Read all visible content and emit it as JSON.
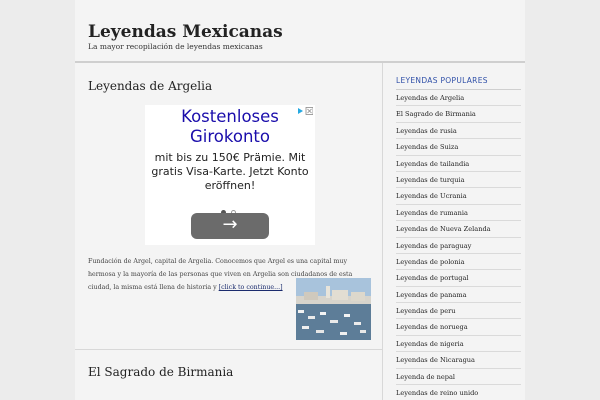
{
  "site": {
    "title": "Leyendas Mexicanas",
    "description": "La mayor recopilación de leyendas mexicanas"
  },
  "posts": [
    {
      "title": "Leyendas de Argelia",
      "excerpt": "Fundación de Argel, capital de Argelia. Conocemos que Argel es una capital muy hermosa y la mayoría de las personas que viven en Argelia son ciudadanos de esta ciudad, la misma está llena de historia y",
      "more_label": "[click to continue...]"
    },
    {
      "title": "El Sagrado de Birmania"
    }
  ],
  "ad": {
    "headline": "Kostenloses Girokonto",
    "body": "mit bis zu 150€ Prämie. Mit gratis Visa-Karte. Jetzt Konto eröffnen!",
    "close_icon": "adchoices-close-icon",
    "arrow_icon": "arrow-right-icon"
  },
  "sidebar": {
    "widget_title": "LEYENDAS POPULARES",
    "items": [
      "Leyendas de Argelia",
      "El Sagrado de Birmania",
      "Leyendas de rusia",
      "Leyendas de Suiza",
      "Leyendas de tailandia",
      "Leyendas de turquia",
      "Leyendas de Ucrania",
      "Leyendas de rumania",
      "Leyendas de Nueva Zelanda",
      "Leyendas de paraguay",
      "Leyendas de polonia",
      "Leyendas de portugal",
      "Leyendas de panama",
      "Leyendas de peru",
      "Leyendas de noruega",
      "Leyendas de nigeria",
      "Leyendas de Nicaragua",
      "Leyenda de nepal",
      "Leyendas de reino unido"
    ]
  },
  "colors": {
    "background": "#ececec",
    "page": "#f4f4f4",
    "link": "#1a2b6d",
    "widget_title": "#3050a8",
    "ad_headline": "#1a0dab"
  }
}
